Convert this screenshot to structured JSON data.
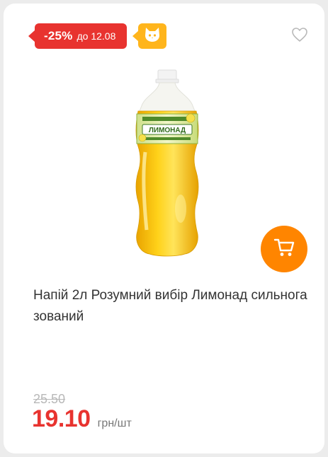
{
  "badges": {
    "discount_percent": "-25%",
    "discount_until": "до 12.08",
    "discount_color": "#e8332f",
    "special_icon": "cat-face-icon",
    "special_color": "#ffb51c"
  },
  "favorite": {
    "icon": "heart-outline-icon"
  },
  "product": {
    "label_text": "ЛИМОНАД",
    "title": "Напій 2л Розумний вибір Лимонад сильногазований"
  },
  "cart": {
    "icon": "cart-icon",
    "color": "#ff8500"
  },
  "pricing": {
    "old_price": "25.50",
    "price": "19.10",
    "unit": "грн/шт"
  }
}
